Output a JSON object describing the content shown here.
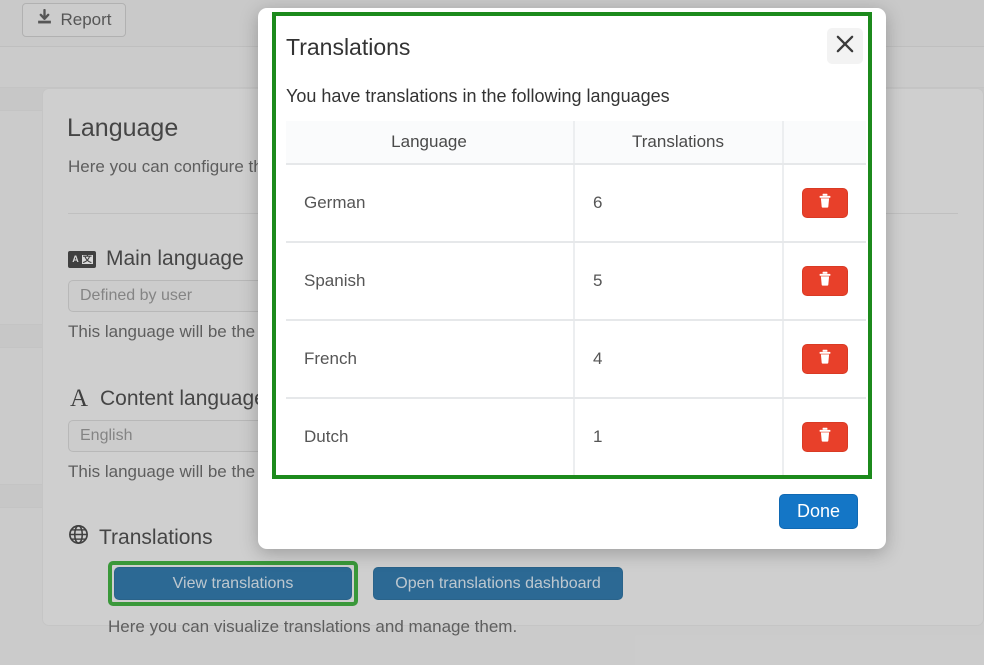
{
  "background": {
    "topbar": {
      "report_label": "Report",
      "report_icon": "download-icon"
    },
    "card": {
      "title": "Language",
      "subtitle": "Here you can configure th",
      "main_language": {
        "icon": "translate-icon",
        "label": "Main language",
        "value": "Defined by user",
        "help": "This language will be the"
      },
      "content_language": {
        "icon": "letter-a-icon",
        "label": "Content language",
        "value": "English",
        "help": "This language will be the"
      },
      "translations": {
        "icon": "globe-icon",
        "label": "Translations",
        "view_button": "View translations",
        "dashboard_button": "Open translations dashboard",
        "help": "Here you can visualize translations and manage them."
      }
    }
  },
  "modal": {
    "title": "Translations",
    "close_icon": "close-icon",
    "description": "You have translations in the following languages",
    "table": {
      "columns": [
        "Language",
        "Translations",
        ""
      ],
      "rows": [
        {
          "language": "German",
          "count": "6",
          "delete_icon": "trash-icon"
        },
        {
          "language": "Spanish",
          "count": "5",
          "delete_icon": "trash-icon"
        },
        {
          "language": "French",
          "count": "4",
          "delete_icon": "trash-icon"
        },
        {
          "language": "Dutch",
          "count": "1",
          "delete_icon": "trash-icon"
        }
      ]
    },
    "done_label": "Done"
  },
  "colors": {
    "highlight_green": "#1c8a1c",
    "primary_blue": "#1476c6",
    "dark_blue": "#1065a0",
    "danger_red": "#e8402a"
  }
}
